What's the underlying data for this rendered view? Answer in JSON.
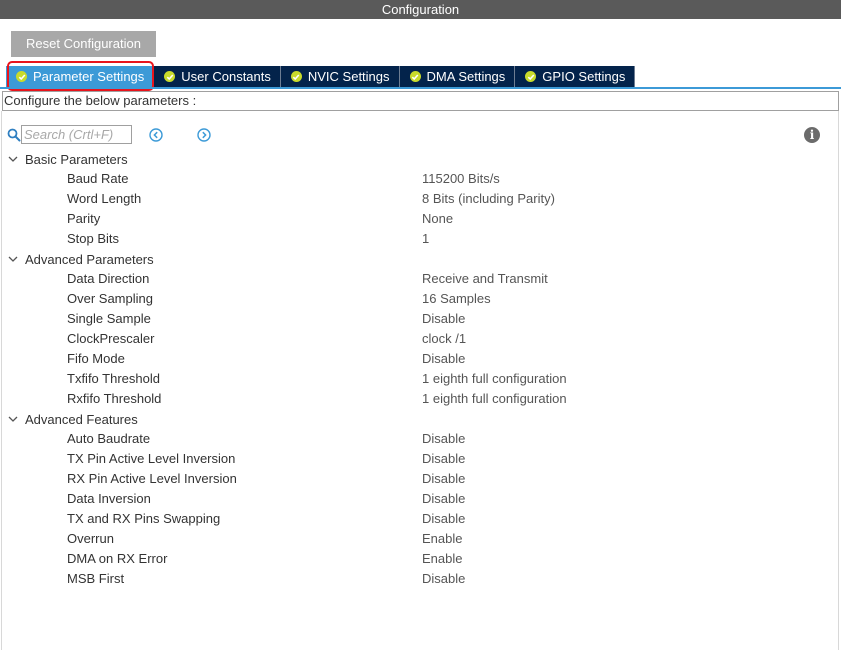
{
  "window": {
    "title": "Configuration"
  },
  "toolbar": {
    "reset_label": "Reset Configuration"
  },
  "tabs": [
    {
      "label": "Parameter Settings",
      "active": true
    },
    {
      "label": "User Constants",
      "active": false
    },
    {
      "label": "NVIC Settings",
      "active": false
    },
    {
      "label": "DMA Settings",
      "active": false
    },
    {
      "label": "GPIO Settings",
      "active": false
    }
  ],
  "colors": {
    "tab_bg": "#03234b",
    "tab_active": "#3c9ad7",
    "check": "#c8db2b",
    "highlight": "#e8141c"
  },
  "info_text": "Configure the below parameters :",
  "search": {
    "placeholder": "Search (Crtl+F)"
  },
  "icons": {
    "search": "search-icon",
    "prev": "left-arrow-circle-icon",
    "next": "right-arrow-circle-icon",
    "info": "info-icon",
    "group": "chevron-down-icon",
    "tab": "check-circle-icon"
  },
  "groups": [
    {
      "label": "Basic Parameters",
      "params": [
        {
          "name": "Baud Rate",
          "value": "115200 Bits/s"
        },
        {
          "name": "Word Length",
          "value": "8 Bits (including Parity)"
        },
        {
          "name": "Parity",
          "value": "None"
        },
        {
          "name": "Stop Bits",
          "value": "1"
        }
      ]
    },
    {
      "label": "Advanced Parameters",
      "params": [
        {
          "name": "Data Direction",
          "value": "Receive and Transmit"
        },
        {
          "name": "Over Sampling",
          "value": "16 Samples"
        },
        {
          "name": "Single Sample",
          "value": "Disable"
        },
        {
          "name": "ClockPrescaler",
          "value": "clock /1"
        },
        {
          "name": "Fifo Mode",
          "value": "Disable"
        },
        {
          "name": "Txfifo Threshold",
          "value": "1 eighth full configuration"
        },
        {
          "name": "Rxfifo Threshold",
          "value": "1 eighth full configuration"
        }
      ]
    },
    {
      "label": "Advanced Features",
      "params": [
        {
          "name": "Auto Baudrate",
          "value": "Disable"
        },
        {
          "name": "TX Pin Active Level Inversion",
          "value": "Disable"
        },
        {
          "name": "RX Pin Active Level Inversion",
          "value": "Disable"
        },
        {
          "name": "Data Inversion",
          "value": "Disable"
        },
        {
          "name": "TX and RX Pins Swapping",
          "value": "Disable"
        },
        {
          "name": "Overrun",
          "value": "Enable"
        },
        {
          "name": "DMA on RX Error",
          "value": "Enable"
        },
        {
          "name": "MSB First",
          "value": "Disable"
        }
      ]
    }
  ]
}
